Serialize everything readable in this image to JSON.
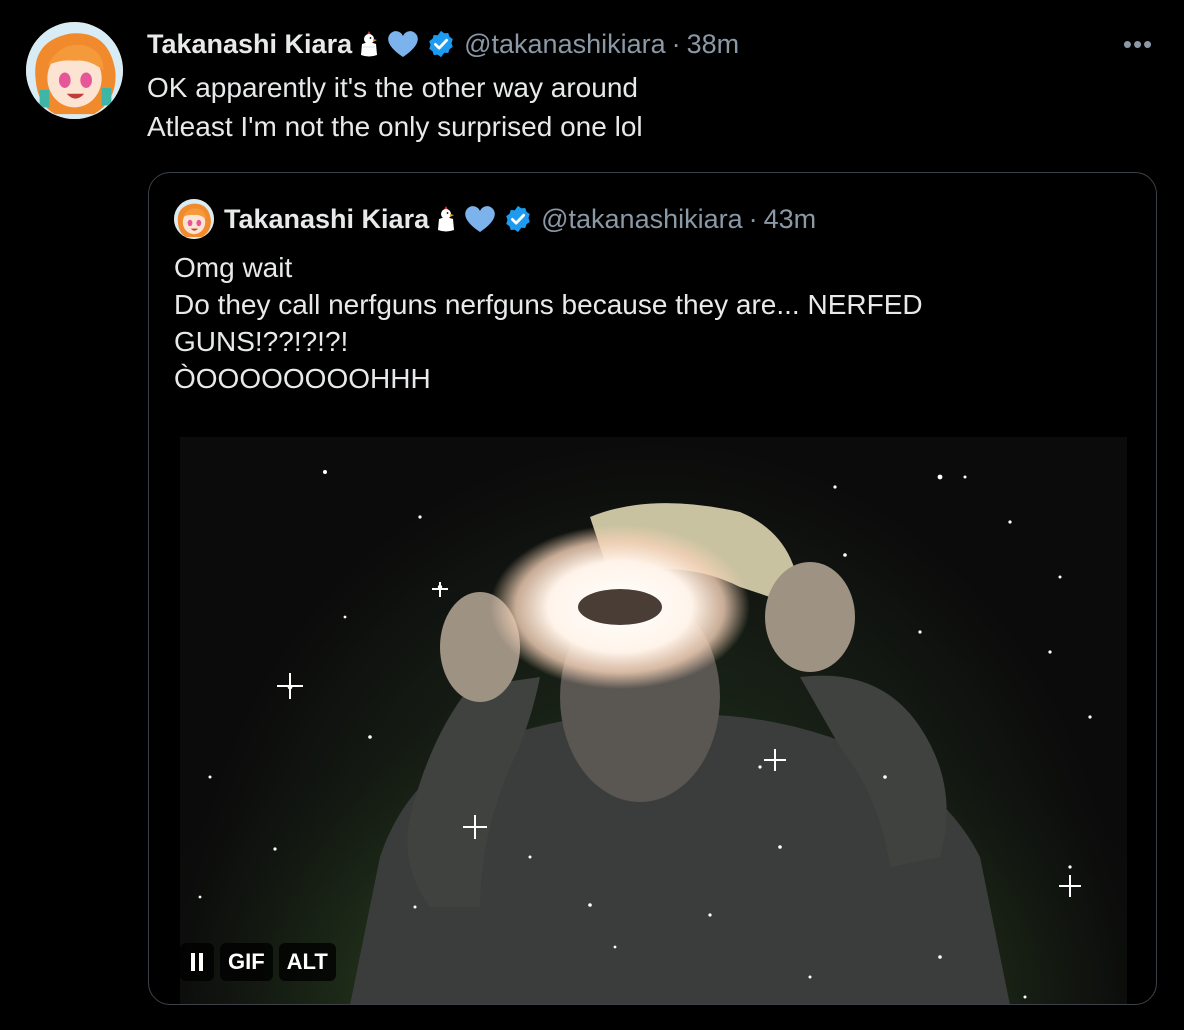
{
  "tweet": {
    "display_name": "Takanashi Kiara",
    "handle": "@takanashikiara",
    "separator": "·",
    "time": "38m",
    "more_label": "•••",
    "lines": [
      "OK apparently it's the other way around",
      "Atleast I'm not the only surprised one lol"
    ]
  },
  "quote": {
    "display_name": "Takanashi Kiara",
    "handle": "@takanashikiara",
    "separator": "·",
    "time": "43m",
    "lines": [
      "Omg wait",
      "Do they call nerfguns nerfguns because they are... NERFED",
      "GUNS!??!?!?!",
      "ÒOOOOOOOOHHH"
    ],
    "media": {
      "gif_label": "GIF",
      "alt_label": "ALT"
    }
  },
  "colors": {
    "background": "#000000",
    "text": "#e7e9ea",
    "secondary": "#8b98a5",
    "verified": "#1d9bf0",
    "heart": "#7db3ec",
    "border": "#3b4147"
  }
}
